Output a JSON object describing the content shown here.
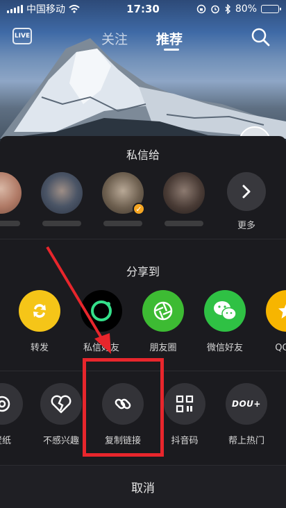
{
  "status_bar": {
    "carrier": "中国移动",
    "time": "17:30",
    "battery": "80%",
    "battery_level": 0.8
  },
  "top_nav": {
    "live_badge": "LIVE",
    "tabs": [
      {
        "label": "关注"
      },
      {
        "label": "推荐"
      }
    ]
  },
  "share_sheet": {
    "dm_title": "私信给",
    "more_label": "更多",
    "share_title": "分享到",
    "share_targets": [
      {
        "label": "转发"
      },
      {
        "label": "私信好友"
      },
      {
        "label": "朋友圈"
      },
      {
        "label": "微信好友"
      },
      {
        "label": "QQ空"
      }
    ],
    "actions": [
      {
        "label": "壁纸"
      },
      {
        "label": "不感兴趣"
      },
      {
        "label": "复制链接"
      },
      {
        "label": "抖音码"
      },
      {
        "label": "帮上热门"
      }
    ],
    "dou_badge": "DOU+",
    "cancel_label": "取消"
  },
  "colors": {
    "sheet_bg": "#1b1b1f",
    "highlight": "#e8262c",
    "forward_yellow": "#f5c518",
    "moments_green": "#3dbb33",
    "wechat_green": "#2fc144",
    "qzone_yellow": "#f7b500",
    "verified_orange": "#f5a623"
  }
}
